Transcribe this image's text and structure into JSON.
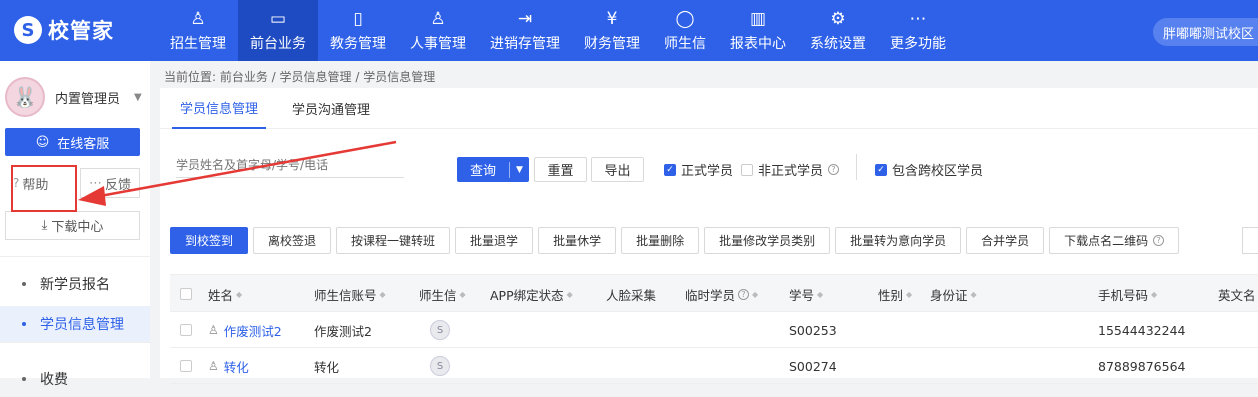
{
  "header": {
    "logo_text": "校管家",
    "nav": [
      {
        "label": "招生管理",
        "icon": "user-add-icon"
      },
      {
        "label": "前台业务",
        "icon": "desk-icon",
        "active": true
      },
      {
        "label": "教务管理",
        "icon": "book-icon"
      },
      {
        "label": "人事管理",
        "icon": "person-icon"
      },
      {
        "label": "进销存管理",
        "icon": "inventory-icon"
      },
      {
        "label": "财务管理",
        "icon": "money-bag-icon"
      },
      {
        "label": "师生信",
        "icon": "chat-icon"
      },
      {
        "label": "报表中心",
        "icon": "report-icon"
      },
      {
        "label": "系统设置",
        "icon": "gear-icon"
      },
      {
        "label": "更多功能",
        "icon": "more-icon"
      }
    ],
    "campus": "胖嘟嘟测试校区"
  },
  "sidebar": {
    "username": "内置管理员",
    "online_service": "在线客服",
    "help": "帮助",
    "feedback": "反馈",
    "download_center": "下载中心",
    "menu": [
      {
        "label": "新学员报名"
      },
      {
        "label": "学员信息管理",
        "active": true
      },
      {
        "label": "收费"
      }
    ]
  },
  "breadcrumb": "当前位置: 前台业务 / 学员信息管理 / 学员信息管理",
  "tabs": [
    "学员信息管理",
    "学员沟通管理"
  ],
  "filters": {
    "search_placeholder": "学员姓名及首字母/学号/电话",
    "query": "查询",
    "reset": "重置",
    "export": "导出",
    "formal": "正式学员",
    "informal": "非正式学员",
    "cross_campus": "包含跨校区学员"
  },
  "actions": [
    "到校签到",
    "离校签退",
    "按课程一键转班",
    "批量退学",
    "批量休学",
    "批量删除",
    "批量修改学员类别",
    "批量转为意向学员",
    "合并学员",
    "下载点名二维码"
  ],
  "table": {
    "columns": [
      "姓名",
      "师生信账号",
      "师生信",
      "APP绑定状态",
      "人脸采集",
      "临时学员",
      "学号",
      "性别",
      "身份证",
      "手机号码",
      "英文名"
    ],
    "rows": [
      {
        "name": "作废测试2",
        "account": "作废测试2",
        "student_no": "S00253",
        "phone": "15544432244"
      },
      {
        "name": "转化",
        "account": "转化",
        "student_no": "S00274",
        "phone": "87889876564"
      }
    ]
  },
  "colors": {
    "primary": "#2e61e8",
    "annotation": "#e53935"
  }
}
